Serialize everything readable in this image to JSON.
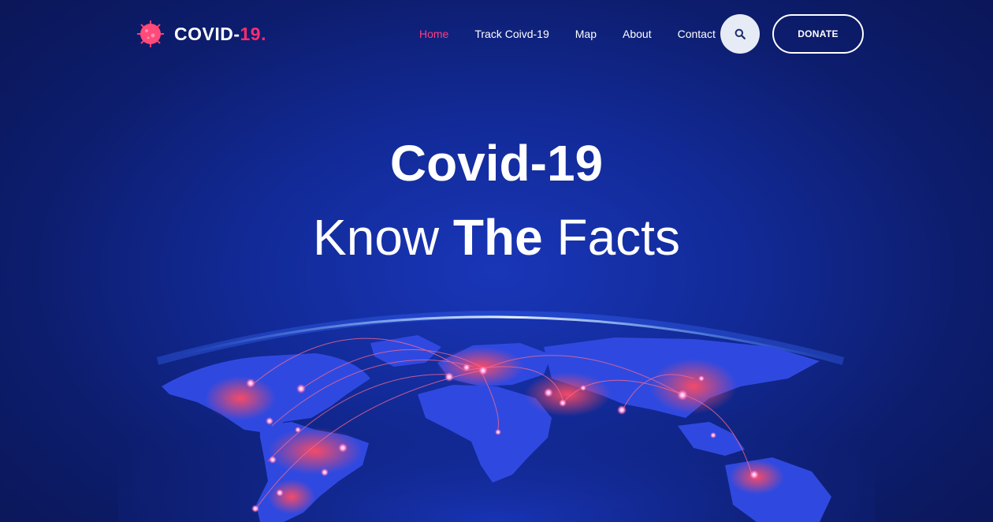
{
  "brand": {
    "name": "COVID-",
    "accent": "19.",
    "accent_color": "#ff2d6f",
    "icon": "virus-icon"
  },
  "nav": {
    "items": [
      {
        "label": "Home",
        "active": true
      },
      {
        "label": "Track Coivd-19",
        "active": false
      },
      {
        "label": "Map",
        "active": false
      },
      {
        "label": "About",
        "active": false
      },
      {
        "label": "Contact",
        "active": false
      }
    ]
  },
  "search": {
    "icon": "search-icon"
  },
  "donate": {
    "label": "DONATE"
  },
  "hero": {
    "title": "Covid-19",
    "sub_pre": "Know ",
    "sub_bold": "The",
    "sub_post": " Facts"
  },
  "colors": {
    "background": "#122a97",
    "accent": "#ff3e7f",
    "land": "#2f49e0",
    "hotspot": "#ff3b5c"
  }
}
